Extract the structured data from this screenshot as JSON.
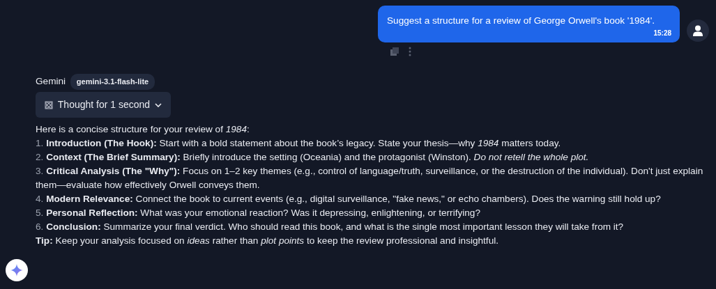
{
  "user_message": {
    "text": "Suggest a structure for a review of George Orwell's book '1984'.",
    "time": "15:28"
  },
  "assistant": {
    "name": "Gemini",
    "model": "gemini-3.1-flash-lite",
    "thought": {
      "label": "Thought for 1 second",
      "expanded": false
    },
    "intro": "Here is a concise structure for your review of *1984*:",
    "items": [
      {
        "number": "1.",
        "title": "Introduction (The Hook):",
        "text": "Start with a bold statement about the book’s legacy. State your thesis—why *1984* matters today."
      },
      {
        "number": "2.",
        "title": "Context (The Brief Summary):",
        "text": "Briefly introduce the setting (Oceania) and the protagonist (Winston). *Do not retell the whole plot.*"
      },
      {
        "number": "3.",
        "title": "Critical Analysis (The \"Why\"):",
        "text": "Focus on 1–2 key themes (e.g., control of language/truth, surveillance, or the destruction of the individual). Don't just explain them—evaluate how effectively Orwell conveys them."
      },
      {
        "number": "4.",
        "title": "Modern Relevance:",
        "text": "Connect the book to current events (e.g., digital surveillance, \"fake news,\" or echo chambers). Does the warning still hold up?"
      },
      {
        "number": "5.",
        "title": "Personal Reflection:",
        "text": "What was your emotional reaction? Was it depressing, enlightening, or terrifying?"
      },
      {
        "number": "6.",
        "title": "Conclusion:",
        "text": "Summarize your final verdict. Who should read this book, and what is the single most important lesson they will take from it?"
      }
    ],
    "tip": {
      "label": "Tip:",
      "text": "Keep your analysis focused on *ideas* rather than *plot points* to keep the review professional and insightful."
    }
  }
}
